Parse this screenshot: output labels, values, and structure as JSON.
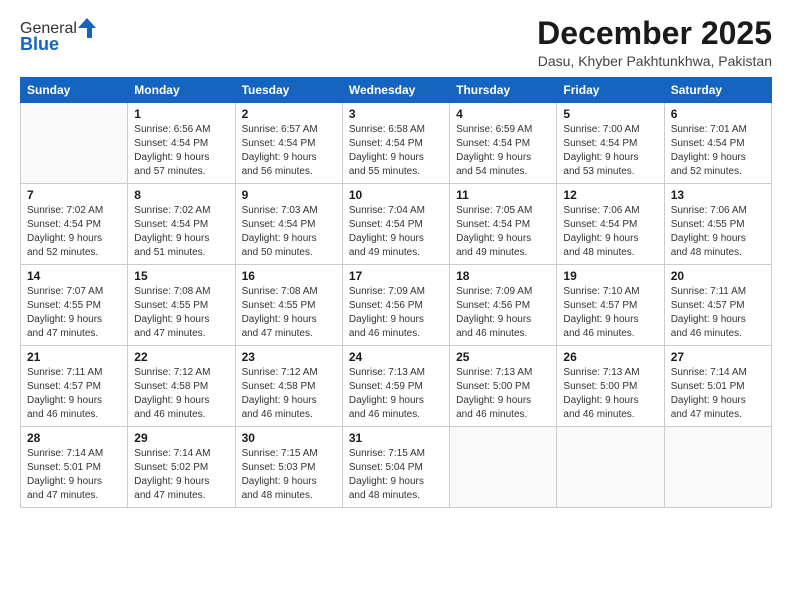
{
  "logo": {
    "general": "General",
    "blue": "Blue"
  },
  "title": "December 2025",
  "location": "Dasu, Khyber Pakhtunkhwa, Pakistan",
  "days_of_week": [
    "Sunday",
    "Monday",
    "Tuesday",
    "Wednesday",
    "Thursday",
    "Friday",
    "Saturday"
  ],
  "weeks": [
    [
      {
        "day": "",
        "detail": ""
      },
      {
        "day": "1",
        "detail": "Sunrise: 6:56 AM\nSunset: 4:54 PM\nDaylight: 9 hours\nand 57 minutes."
      },
      {
        "day": "2",
        "detail": "Sunrise: 6:57 AM\nSunset: 4:54 PM\nDaylight: 9 hours\nand 56 minutes."
      },
      {
        "day": "3",
        "detail": "Sunrise: 6:58 AM\nSunset: 4:54 PM\nDaylight: 9 hours\nand 55 minutes."
      },
      {
        "day": "4",
        "detail": "Sunrise: 6:59 AM\nSunset: 4:54 PM\nDaylight: 9 hours\nand 54 minutes."
      },
      {
        "day": "5",
        "detail": "Sunrise: 7:00 AM\nSunset: 4:54 PM\nDaylight: 9 hours\nand 53 minutes."
      },
      {
        "day": "6",
        "detail": "Sunrise: 7:01 AM\nSunset: 4:54 PM\nDaylight: 9 hours\nand 52 minutes."
      }
    ],
    [
      {
        "day": "7",
        "detail": "Sunrise: 7:02 AM\nSunset: 4:54 PM\nDaylight: 9 hours\nand 52 minutes."
      },
      {
        "day": "8",
        "detail": "Sunrise: 7:02 AM\nSunset: 4:54 PM\nDaylight: 9 hours\nand 51 minutes."
      },
      {
        "day": "9",
        "detail": "Sunrise: 7:03 AM\nSunset: 4:54 PM\nDaylight: 9 hours\nand 50 minutes."
      },
      {
        "day": "10",
        "detail": "Sunrise: 7:04 AM\nSunset: 4:54 PM\nDaylight: 9 hours\nand 49 minutes."
      },
      {
        "day": "11",
        "detail": "Sunrise: 7:05 AM\nSunset: 4:54 PM\nDaylight: 9 hours\nand 49 minutes."
      },
      {
        "day": "12",
        "detail": "Sunrise: 7:06 AM\nSunset: 4:54 PM\nDaylight: 9 hours\nand 48 minutes."
      },
      {
        "day": "13",
        "detail": "Sunrise: 7:06 AM\nSunset: 4:55 PM\nDaylight: 9 hours\nand 48 minutes."
      }
    ],
    [
      {
        "day": "14",
        "detail": "Sunrise: 7:07 AM\nSunset: 4:55 PM\nDaylight: 9 hours\nand 47 minutes."
      },
      {
        "day": "15",
        "detail": "Sunrise: 7:08 AM\nSunset: 4:55 PM\nDaylight: 9 hours\nand 47 minutes."
      },
      {
        "day": "16",
        "detail": "Sunrise: 7:08 AM\nSunset: 4:55 PM\nDaylight: 9 hours\nand 47 minutes."
      },
      {
        "day": "17",
        "detail": "Sunrise: 7:09 AM\nSunset: 4:56 PM\nDaylight: 9 hours\nand 46 minutes."
      },
      {
        "day": "18",
        "detail": "Sunrise: 7:09 AM\nSunset: 4:56 PM\nDaylight: 9 hours\nand 46 minutes."
      },
      {
        "day": "19",
        "detail": "Sunrise: 7:10 AM\nSunset: 4:57 PM\nDaylight: 9 hours\nand 46 minutes."
      },
      {
        "day": "20",
        "detail": "Sunrise: 7:11 AM\nSunset: 4:57 PM\nDaylight: 9 hours\nand 46 minutes."
      }
    ],
    [
      {
        "day": "21",
        "detail": "Sunrise: 7:11 AM\nSunset: 4:57 PM\nDaylight: 9 hours\nand 46 minutes."
      },
      {
        "day": "22",
        "detail": "Sunrise: 7:12 AM\nSunset: 4:58 PM\nDaylight: 9 hours\nand 46 minutes."
      },
      {
        "day": "23",
        "detail": "Sunrise: 7:12 AM\nSunset: 4:58 PM\nDaylight: 9 hours\nand 46 minutes."
      },
      {
        "day": "24",
        "detail": "Sunrise: 7:13 AM\nSunset: 4:59 PM\nDaylight: 9 hours\nand 46 minutes."
      },
      {
        "day": "25",
        "detail": "Sunrise: 7:13 AM\nSunset: 5:00 PM\nDaylight: 9 hours\nand 46 minutes."
      },
      {
        "day": "26",
        "detail": "Sunrise: 7:13 AM\nSunset: 5:00 PM\nDaylight: 9 hours\nand 46 minutes."
      },
      {
        "day": "27",
        "detail": "Sunrise: 7:14 AM\nSunset: 5:01 PM\nDaylight: 9 hours\nand 47 minutes."
      }
    ],
    [
      {
        "day": "28",
        "detail": "Sunrise: 7:14 AM\nSunset: 5:01 PM\nDaylight: 9 hours\nand 47 minutes."
      },
      {
        "day": "29",
        "detail": "Sunrise: 7:14 AM\nSunset: 5:02 PM\nDaylight: 9 hours\nand 47 minutes."
      },
      {
        "day": "30",
        "detail": "Sunrise: 7:15 AM\nSunset: 5:03 PM\nDaylight: 9 hours\nand 48 minutes."
      },
      {
        "day": "31",
        "detail": "Sunrise: 7:15 AM\nSunset: 5:04 PM\nDaylight: 9 hours\nand 48 minutes."
      },
      {
        "day": "",
        "detail": ""
      },
      {
        "day": "",
        "detail": ""
      },
      {
        "day": "",
        "detail": ""
      }
    ]
  ]
}
